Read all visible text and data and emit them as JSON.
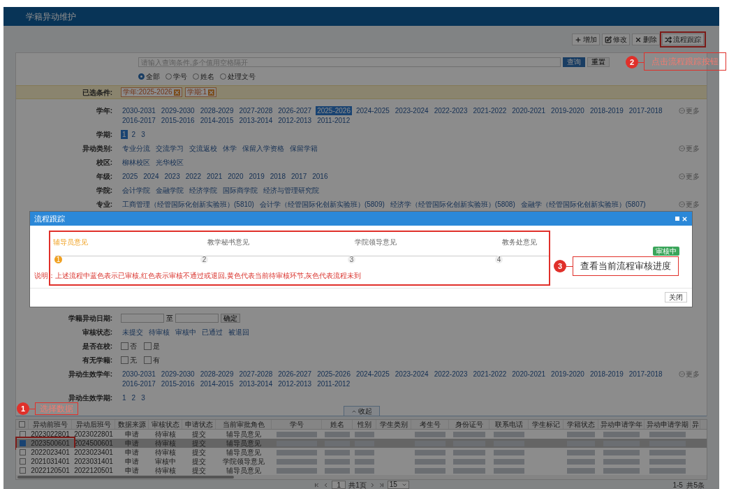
{
  "header": {
    "title": "学籍异动维护"
  },
  "toolbar": [
    {
      "kind": "plus",
      "label": "增加"
    },
    {
      "kind": "edit",
      "label": "修改"
    },
    {
      "kind": "delete",
      "label": "删除"
    },
    {
      "kind": "shuffle",
      "label": "流程跟踪"
    }
  ],
  "search": {
    "placeholder": "请输入查询条件,多个值用空格隔开",
    "buttons": [
      "查询",
      "重置"
    ],
    "modes": [
      {
        "label": "全部",
        "selected": true
      },
      {
        "label": "学号",
        "selected": false
      },
      {
        "label": "姓名",
        "selected": false
      },
      {
        "label": "处理文号",
        "selected": false
      }
    ]
  },
  "selected_conditions": {
    "label": "已选条件:",
    "tags": [
      "学年:2025-2026",
      "学期:1"
    ]
  },
  "filters": [
    {
      "kind": "links",
      "label": "学年:",
      "more": "更多",
      "options": [
        {
          "label": "2030-2031",
          "selected": false
        },
        {
          "label": "2029-2030",
          "selected": false
        },
        {
          "label": "2028-2029",
          "selected": false
        },
        {
          "label": "2027-2028",
          "selected": false
        },
        {
          "label": "2026-2027",
          "selected": false
        },
        {
          "label": "2025-2026",
          "selected": true
        },
        {
          "label": "2024-2025",
          "selected": false
        },
        {
          "label": "2023-2024",
          "selected": false
        },
        {
          "label": "2022-2023",
          "selected": false
        },
        {
          "label": "2021-2022",
          "selected": false
        },
        {
          "label": "2020-2021",
          "selected": false
        },
        {
          "label": "2019-2020",
          "selected": false
        },
        {
          "label": "2018-2019",
          "selected": false
        },
        {
          "label": "2017-2018",
          "selected": false
        },
        {
          "label": "2016-2017",
          "selected": false
        },
        {
          "label": "2015-2016",
          "selected": false
        },
        {
          "label": "2014-2015",
          "selected": false
        },
        {
          "label": "2013-2014",
          "selected": false
        },
        {
          "label": "2012-2013",
          "selected": false
        },
        {
          "label": "2011-2012",
          "selected": false
        }
      ]
    },
    {
      "kind": "links",
      "label": "学期:",
      "options": [
        {
          "label": "1",
          "selected": true
        },
        {
          "label": "2",
          "selected": false
        },
        {
          "label": "3",
          "selected": false
        }
      ]
    },
    {
      "kind": "links",
      "label": "异动类别:",
      "more": "更多",
      "options": [
        {
          "label": "专业分流",
          "selected": false
        },
        {
          "label": "交流学习",
          "selected": false
        },
        {
          "label": "交流返校",
          "selected": false
        },
        {
          "label": "休学",
          "selected": false
        },
        {
          "label": "保留入学资格",
          "selected": false
        },
        {
          "label": "保留学籍",
          "selected": false
        }
      ]
    },
    {
      "kind": "links",
      "label": "校区:",
      "options": [
        {
          "label": "柳林校区",
          "selected": false
        },
        {
          "label": "光华校区",
          "selected": false
        }
      ]
    },
    {
      "kind": "links",
      "label": "年级:",
      "more": "更多",
      "options": [
        {
          "label": "2025",
          "selected": false
        },
        {
          "label": "2024",
          "selected": false
        },
        {
          "label": "2023",
          "selected": false
        },
        {
          "label": "2022",
          "selected": false
        },
        {
          "label": "2021",
          "selected": false
        },
        {
          "label": "2020",
          "selected": false
        },
        {
          "label": "2019",
          "selected": false
        },
        {
          "label": "2018",
          "selected": false
        },
        {
          "label": "2017",
          "selected": false
        },
        {
          "label": "2016",
          "selected": false
        }
      ]
    },
    {
      "kind": "links",
      "label": "学院:",
      "options": [
        {
          "label": "会计学院",
          "selected": false
        },
        {
          "label": "金融学院",
          "selected": false
        },
        {
          "label": "经济学院",
          "selected": false
        },
        {
          "label": "国际商学院",
          "selected": false
        },
        {
          "label": "经济与管理研究院",
          "selected": false
        }
      ]
    },
    {
      "kind": "links",
      "label": "专业:",
      "more": "更多",
      "options": [
        {
          "label": "工商管理（经管国际化创新实验班）(5810)",
          "selected": false
        },
        {
          "label": "会计学（经管国际化创新实验班）(5809)",
          "selected": false
        },
        {
          "label": "经济学（经管国际化创新实验班）(5808)",
          "selected": false
        },
        {
          "label": "金融学（经管国际化创新实验班）(5807)",
          "selected": false
        }
      ]
    }
  ],
  "filters_lower": [
    {
      "kind": "date_range",
      "label": "学籍异动日期:",
      "separator": "至",
      "button": "确定"
    },
    {
      "kind": "links",
      "label": "审核状态:",
      "options": [
        {
          "label": "未提交",
          "selected": false
        },
        {
          "label": "待审核",
          "selected": false
        },
        {
          "label": "审核中",
          "selected": false
        },
        {
          "label": "已通过",
          "selected": false
        },
        {
          "label": "被退回",
          "selected": false
        }
      ]
    },
    {
      "kind": "checkboxes",
      "label": "是否在校:",
      "options": [
        {
          "label": "否",
          "checked": false
        },
        {
          "label": "是",
          "checked": false
        }
      ]
    },
    {
      "kind": "checkboxes",
      "label": "有无学籍:",
      "options": [
        {
          "label": "无",
          "checked": false
        },
        {
          "label": "有",
          "checked": false
        }
      ]
    },
    {
      "kind": "links",
      "label": "异动生效学年:",
      "more": "更多",
      "options": [
        {
          "label": "2030-2031",
          "selected": false
        },
        {
          "label": "2029-2030",
          "selected": false
        },
        {
          "label": "2028-2029",
          "selected": false
        },
        {
          "label": "2027-2028",
          "selected": false
        },
        {
          "label": "2026-2027",
          "selected": false
        },
        {
          "label": "2025-2026",
          "selected": false
        },
        {
          "label": "2024-2025",
          "selected": false
        },
        {
          "label": "2023-2024",
          "selected": false
        },
        {
          "label": "2022-2023",
          "selected": false
        },
        {
          "label": "2021-2022",
          "selected": false
        },
        {
          "label": "2020-2021",
          "selected": false
        },
        {
          "label": "2019-2020",
          "selected": false
        },
        {
          "label": "2018-2019",
          "selected": false
        },
        {
          "label": "2017-2018",
          "selected": false
        },
        {
          "label": "2016-2017",
          "selected": false
        },
        {
          "label": "2015-2016",
          "selected": false
        },
        {
          "label": "2014-2015",
          "selected": false
        },
        {
          "label": "2013-2014",
          "selected": false
        },
        {
          "label": "2012-2013",
          "selected": false
        },
        {
          "label": "2011-2012",
          "selected": false
        }
      ]
    },
    {
      "kind": "links",
      "label": "异动生效学期:",
      "options": [
        {
          "label": "1",
          "selected": false
        },
        {
          "label": "2",
          "selected": false
        },
        {
          "label": "3",
          "selected": false
        }
      ]
    }
  ],
  "collapse_tab": "收起",
  "table": {
    "header_checked": false,
    "columns": [
      {
        "label": "异动前班号",
        "kind": "text"
      },
      {
        "label": "异动后班号",
        "kind": "text"
      },
      {
        "label": "数据来源",
        "kind": "text"
      },
      {
        "label": "审核状态",
        "kind": "text"
      },
      {
        "label": "申请状态",
        "kind": "text"
      },
      {
        "label": "当前审批角色",
        "kind": "text"
      },
      {
        "label": "学号",
        "kind": "blurred"
      },
      {
        "label": "姓名",
        "kind": "blurred"
      },
      {
        "label": "性别",
        "kind": "blurred"
      },
      {
        "label": "学生类别",
        "kind": "empty"
      },
      {
        "label": "考生号",
        "kind": "blurred"
      },
      {
        "label": "身份证号",
        "kind": "blurred"
      },
      {
        "label": "联系电话",
        "kind": "blurred"
      },
      {
        "label": "学生标记",
        "kind": "empty"
      },
      {
        "label": "学籍状态",
        "kind": "blurred"
      },
      {
        "label": "异动申请学年",
        "kind": "blurred"
      },
      {
        "label": "异动申请学期",
        "kind": "blurred"
      },
      {
        "label": "异",
        "kind": "empty"
      }
    ],
    "rows": [
      {
        "selected": false,
        "cells": [
          "2023022801",
          "2023022801",
          "申请",
          "待审核",
          "提交",
          "辅导员意见"
        ]
      },
      {
        "selected": true,
        "cells": [
          "2023500601",
          "2024500601",
          "申请",
          "待审核",
          "提交",
          "辅导员意见"
        ]
      },
      {
        "selected": false,
        "cells": [
          "2022023401",
          "2023023401",
          "申请",
          "待审核",
          "提交",
          "辅导员意见"
        ]
      },
      {
        "selected": false,
        "cells": [
          "2021031401",
          "2023031401",
          "申请",
          "审核中",
          "提交",
          "学院领导意见"
        ]
      },
      {
        "selected": false,
        "cells": [
          "2022120501",
          "2022120501",
          "申请",
          "待审核",
          "提交",
          "辅导员意见"
        ]
      }
    ]
  },
  "pager": {
    "page": "1",
    "total_pages": "共1页",
    "page_size": "15",
    "summary": "1-5  共5条"
  },
  "modal": {
    "title": "流程跟踪",
    "steps": [
      {
        "label": "辅导员意见",
        "number": "1",
        "current": true
      },
      {
        "label": "教学秘书意见",
        "number": "2",
        "current": false
      },
      {
        "label": "学院领导意见",
        "number": "3",
        "current": false
      },
      {
        "label": "教务处意见",
        "number": "4",
        "current": false
      }
    ],
    "status_badge": "审核中",
    "note": "说明：上述流程中蓝色表示已审核,红色表示审核不通过或退回,黄色代表当前待审核环节,灰色代表流程未到",
    "close_button": "关闭"
  },
  "annotations": [
    {
      "number": "1",
      "text": "选择数据",
      "kind": "faded"
    },
    {
      "number": "2",
      "text": "点击流程跟踪按钮",
      "kind": "faded"
    },
    {
      "number": "3",
      "text": "查看当前流程审核进度",
      "kind": "solid"
    }
  ]
}
